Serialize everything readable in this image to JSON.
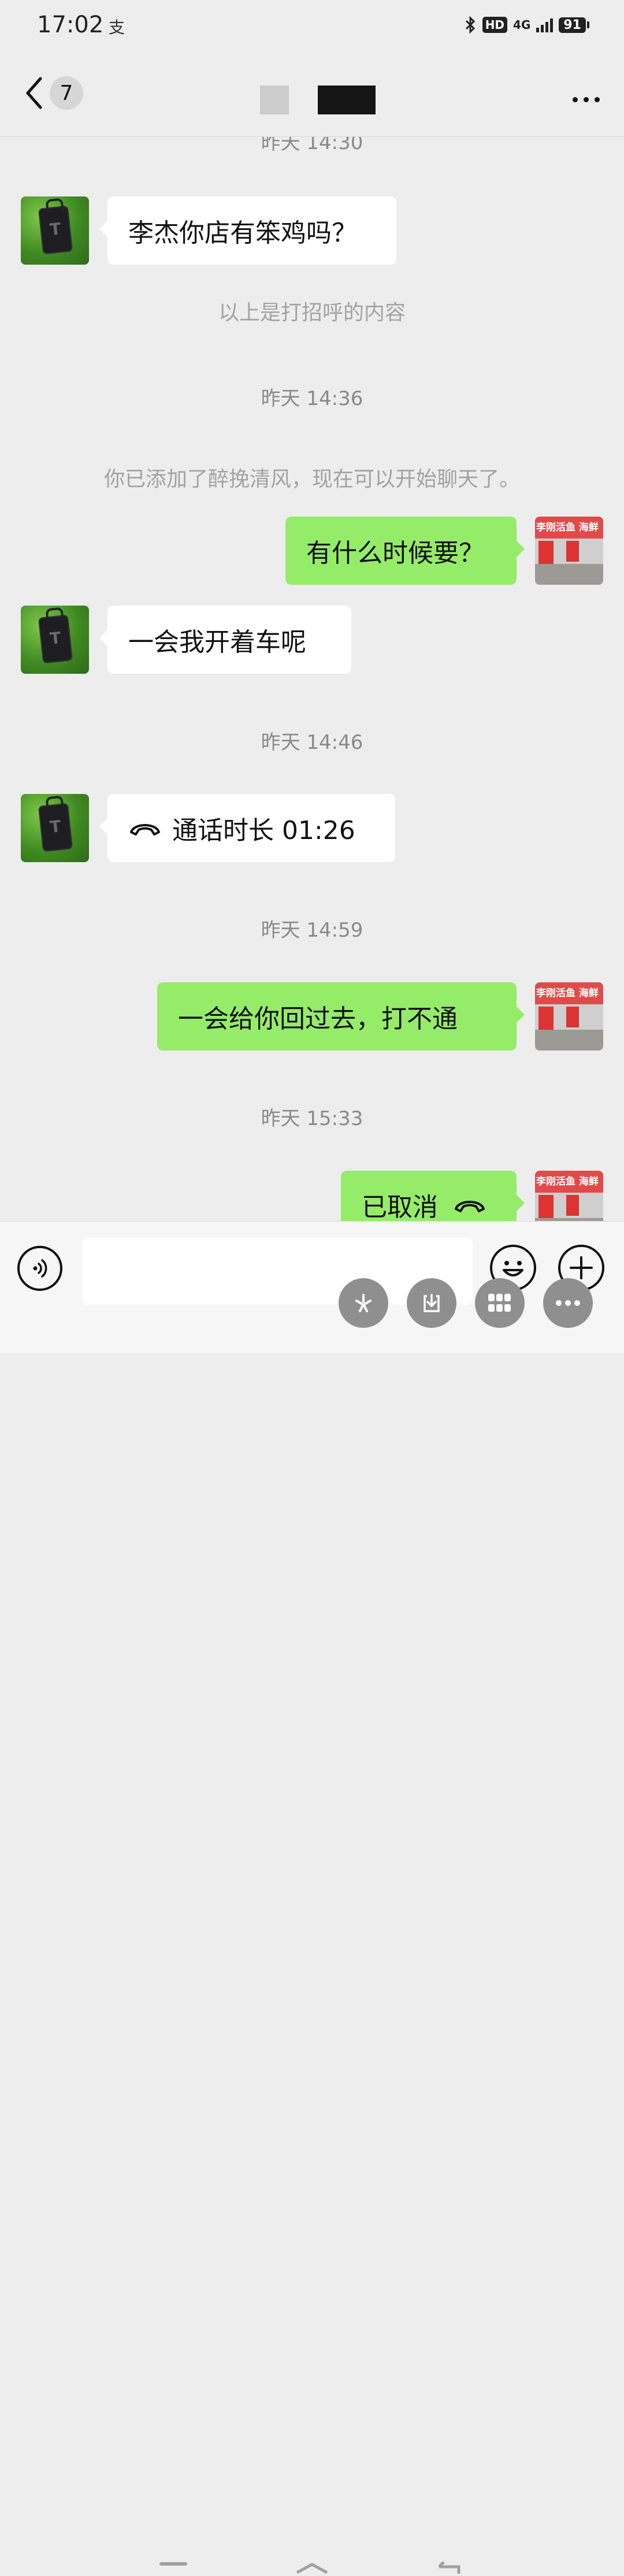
{
  "status_bar": {
    "time": "17:02",
    "app_indicator": "支",
    "hd_label": "HD",
    "network": "4G",
    "battery": "91"
  },
  "header": {
    "unread_count": "7"
  },
  "messages": {
    "ts1": "昨天 14:30",
    "m1": "李杰你店有笨鸡吗？",
    "sys1": "以上是打招呼的内容",
    "ts2": "昨天 14:36",
    "sys2": "你已添加了醉挽清风，现在可以开始聊天了。",
    "m2": "有什么时候要？",
    "m3": "一会我开着车呢",
    "ts3": "昨天 14:46",
    "m4": "通话时长 01:26",
    "ts4": "昨天 14:59",
    "m5": "一会给你回过去，打不通",
    "ts5": "昨天 15:33",
    "m6": "已取消"
  },
  "avatars": {
    "self_sign_text": "李刚活鱼 海鲜"
  },
  "input": {
    "value": ""
  },
  "icons": [
    "back-chevron-icon",
    "more-dots-icon",
    "voice-icon",
    "emoji-icon",
    "plus-icon",
    "phone-hangup-icon",
    "bluetooth-icon",
    "signal-icon",
    "battery-icon"
  ],
  "colors": {
    "background": "#ededed",
    "bubble_self": "#95ec69",
    "bubble_other": "#ffffff",
    "timestamp": "#8a8a8a"
  }
}
